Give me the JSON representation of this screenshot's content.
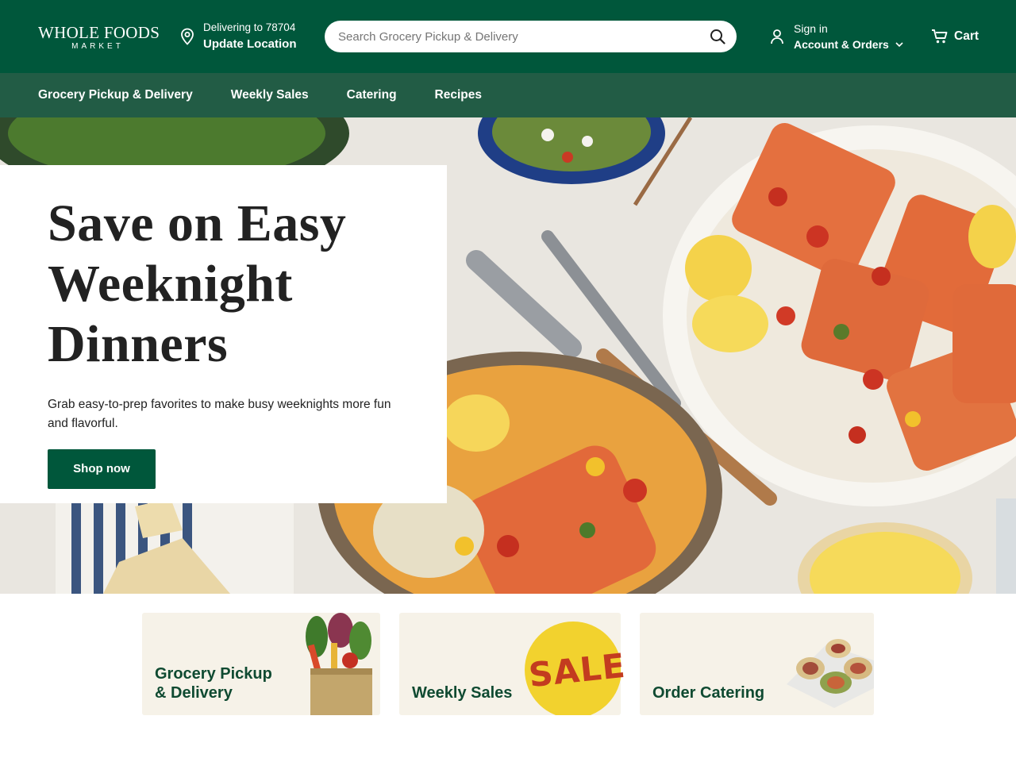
{
  "header": {
    "logo_main": "WHOLE FOODS",
    "logo_sub": "MARKET",
    "location_line1": "Delivering to 78704",
    "location_line2": "Update Location",
    "search_placeholder": "Search Grocery Pickup & Delivery",
    "account_line1": "Sign in",
    "account_line2": "Account & Orders",
    "cart_label": "Cart"
  },
  "nav": {
    "items": [
      {
        "label": "Grocery Pickup & Delivery"
      },
      {
        "label": "Weekly Sales"
      },
      {
        "label": "Catering"
      },
      {
        "label": "Recipes"
      }
    ]
  },
  "hero": {
    "title": "Save on Easy Weeknight Dinners",
    "description": "Grab easy-to-prep favorites to make busy weeknights more fun and flavorful.",
    "button_label": "Shop now"
  },
  "tiles": [
    {
      "label_line1": "Grocery Pickup",
      "label_line2": "& Delivery"
    },
    {
      "label": "Weekly Sales",
      "badge": "SALE"
    },
    {
      "label": "Order Catering"
    }
  ],
  "colors": {
    "brand_green": "#00573b",
    "nav_green": "#225c45",
    "tile_bg": "#f6f2e8",
    "tile_text": "#0f4a31",
    "sale_yellow": "#f2d22e"
  }
}
